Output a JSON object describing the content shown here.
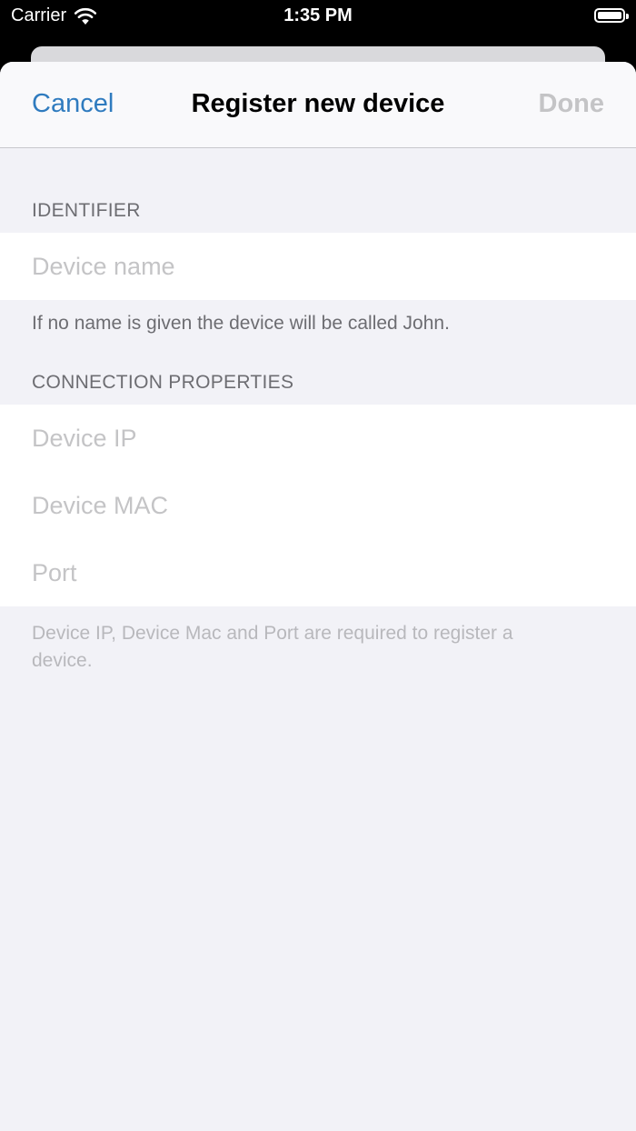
{
  "status_bar": {
    "carrier": "Carrier",
    "time": "1:35 PM"
  },
  "nav": {
    "cancel_label": "Cancel",
    "title": "Register new device",
    "done_label": "Done"
  },
  "identifier_section": {
    "header": "IDENTIFIER",
    "device_name_placeholder": "Device name",
    "device_name_value": "",
    "footer": "If no name is given the device will be called John."
  },
  "connection_section": {
    "header": "CONNECTION PROPERTIES",
    "device_ip_placeholder": "Device IP",
    "device_mac_placeholder": "Device MAC",
    "port_placeholder": "Port",
    "footer": "Device IP, Device Mac and Port are required to register a device."
  },
  "colors": {
    "accent": "#2f7bbf",
    "disabled": "#c4c4c6",
    "grouped_background": "#f2f2f7",
    "secondary_text": "#6d6d72"
  },
  "icons": [
    "wifi-icon",
    "battery-icon"
  ]
}
